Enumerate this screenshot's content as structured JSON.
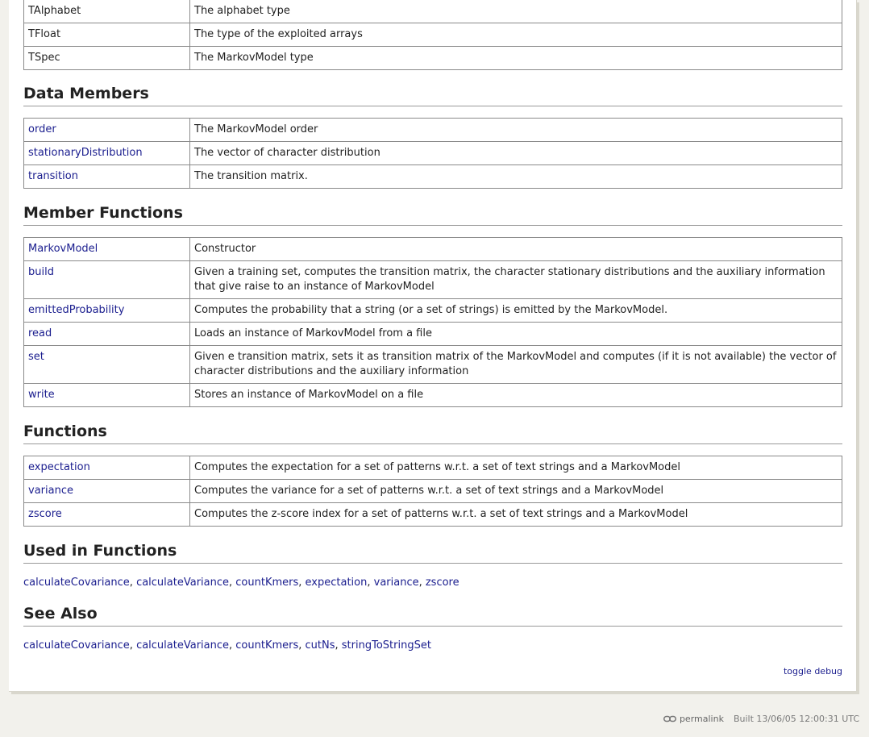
{
  "types": [
    {
      "name": "TAlphabet",
      "desc": "The alphabet type"
    },
    {
      "name": "TFloat",
      "desc": "The type of the exploited arrays"
    },
    {
      "name": "TSpec",
      "desc": "The MarkovModel type"
    }
  ],
  "data_members": {
    "heading": "Data Members",
    "rows": [
      {
        "name": "order",
        "desc": "The MarkovModel order"
      },
      {
        "name": "stationaryDistribution",
        "desc": "The vector of character distribution"
      },
      {
        "name": "transition",
        "desc": "The transition matrix."
      }
    ]
  },
  "member_functions": {
    "heading": "Member Functions",
    "rows": [
      {
        "name": "MarkovModel",
        "desc": "Constructor"
      },
      {
        "name": "build",
        "desc": "Given a training set, computes the transition matrix, the character stationary distributions and the auxiliary information that give raise to an instance of MarkovModel"
      },
      {
        "name": "emittedProbability",
        "desc": "Computes the probability that a string (or a set of strings) is emitted by the MarkovModel."
      },
      {
        "name": "read",
        "desc": "Loads an instance of MarkovModel from a file"
      },
      {
        "name": "set",
        "desc": "Given e transition matrix, sets it as transition matrix of the MarkovModel and computes (if it is not available) the vector of character distributions and the auxiliary information"
      },
      {
        "name": "write",
        "desc": "Stores an instance of MarkovModel on a file"
      }
    ]
  },
  "functions": {
    "heading": "Functions",
    "rows": [
      {
        "name": "expectation",
        "desc": "Computes the expectation for a set of patterns w.r.t. a set of text strings and a MarkovModel"
      },
      {
        "name": "variance",
        "desc": "Computes the variance for a set of patterns w.r.t. a set of text strings and a MarkovModel"
      },
      {
        "name": "zscore",
        "desc": "Computes the z-score index for a set of patterns w.r.t. a set of text strings and a MarkovModel"
      }
    ]
  },
  "used_in": {
    "heading": "Used in Functions",
    "links": [
      "calculateCovariance",
      "calculateVariance",
      "countKmers",
      "expectation",
      "variance",
      "zscore"
    ]
  },
  "see_also": {
    "heading": "See Also",
    "links": [
      "calculateCovariance",
      "calculateVariance",
      "countKmers",
      "cutNs",
      "stringToStringSet"
    ]
  },
  "toggle_debug": "toggle debug",
  "footer": {
    "permalink_icon": "link-icon",
    "permalink": "permalink",
    "built": "Built 13/06/05 12:00:31 UTC"
  },
  "colors": {
    "link": "#1a1d8e",
    "background": "#f2f1ec",
    "border": "#8a8a8a"
  }
}
